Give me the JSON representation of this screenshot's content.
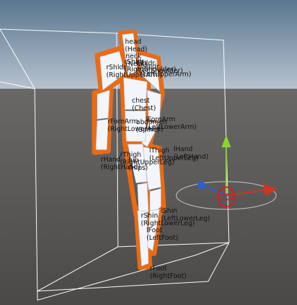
{
  "scene": {
    "sky_top": "#5a7690",
    "sky_bottom": "#b8c4cf",
    "ground_far": "#6a6866",
    "ground_near": "#4a4948",
    "bone_fill": "#f2f5fa",
    "bone_shade": "#aab3c0",
    "selection_outline": "#ec6a13",
    "bounds_color": "#ffffff"
  },
  "gizmo": {
    "x_axis_color": "#d1351e",
    "y_axis_color": "#86d82c",
    "z_axis_color": "#2a5fd6",
    "rotation_ring_color": "#d81c1c"
  },
  "bones": [
    {
      "id": "head",
      "name": "head",
      "human": "(Head)"
    },
    {
      "id": "neck",
      "name": "neck",
      "human": "(Neck)"
    },
    {
      "id": "l-shoulder",
      "name": "lShldr",
      "human": "(LeftShoulder)"
    },
    {
      "id": "r-shoulder",
      "name": "rShldr",
      "human": "(RightShoulder)"
    },
    {
      "id": "r-upper-arm",
      "name": "rShldr",
      "human": "(RightUpperArm)"
    },
    {
      "id": "l-upper-arm",
      "name": "lShldr",
      "human": "(LeftUpperArm)"
    },
    {
      "id": "chest",
      "name": "chest",
      "human": "(Chest)"
    },
    {
      "id": "l-forearm",
      "name": "lForeArm",
      "human": "(LeftLowerArm)"
    },
    {
      "id": "r-forearm",
      "name": "rForeArm",
      "human": "(RightLowerArm)"
    },
    {
      "id": "abdomen",
      "name": "abdomen",
      "human": "(Spine)"
    },
    {
      "id": "hip",
      "name": "hip",
      "human": "(Hips)"
    },
    {
      "id": "r-thigh",
      "name": "rThigh",
      "human": "(RightUpperLeg)"
    },
    {
      "id": "l-thigh",
      "name": "lThigh",
      "human": "(LeftUpperLeg)"
    },
    {
      "id": "l-hand",
      "name": "lHand",
      "human": "(LeftHand)"
    },
    {
      "id": "r-hand",
      "name": "rHand",
      "human": "(RightHand)"
    },
    {
      "id": "l-shin",
      "name": "lShin",
      "human": "(LeftLowerLeg)"
    },
    {
      "id": "r-shin",
      "name": "rShin",
      "human": "(RightLowerLeg)"
    },
    {
      "id": "l-foot",
      "name": "lFoot",
      "human": "(LeftFoot)"
    },
    {
      "id": "r-foot",
      "name": "rFoot",
      "human": "(RightFoot)"
    }
  ]
}
